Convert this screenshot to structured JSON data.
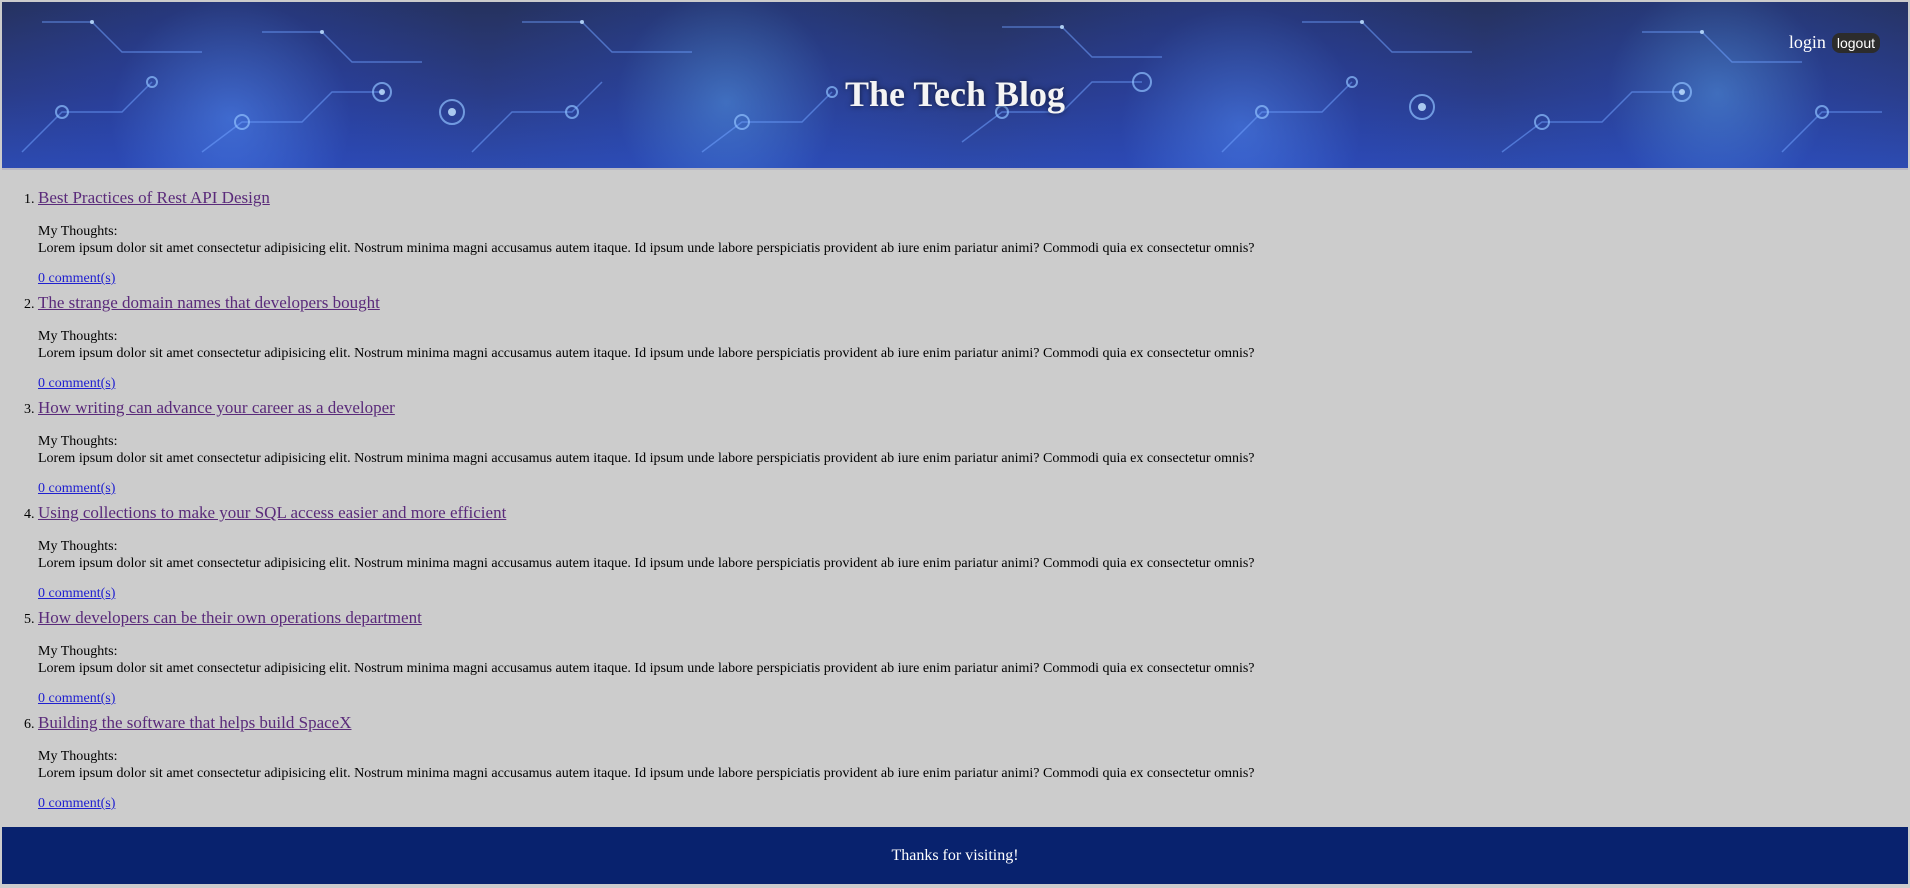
{
  "header": {
    "title": "The Tech Blog",
    "login_label": "login",
    "logout_label": "logout",
    "bg_color": "#2a3c86"
  },
  "posts": [
    {
      "number": "1.",
      "title": "Best Practices of Rest API Design",
      "thoughts_label": "My Thoughts:",
      "body": "Lorem ipsum dolor sit amet consectetur adipisicing elit. Nostrum minima magni accusamus autem itaque. Id ipsum unde labore perspiciatis provident ab iure enim pariatur animi? Commodi quia ex consectetur omnis?",
      "comments": "0 comment(s)"
    },
    {
      "number": "2.",
      "title": "The strange domain names that developers bought",
      "thoughts_label": "My Thoughts:",
      "body": "Lorem ipsum dolor sit amet consectetur adipisicing elit. Nostrum minima magni accusamus autem itaque. Id ipsum unde labore perspiciatis provident ab iure enim pariatur animi? Commodi quia ex consectetur omnis?",
      "comments": "0 comment(s)"
    },
    {
      "number": "3.",
      "title": "How writing can advance your career as a developer",
      "thoughts_label": "My Thoughts:",
      "body": "Lorem ipsum dolor sit amet consectetur adipisicing elit. Nostrum minima magni accusamus autem itaque. Id ipsum unde labore perspiciatis provident ab iure enim pariatur animi? Commodi quia ex consectetur omnis?",
      "comments": "0 comment(s)"
    },
    {
      "number": "4.",
      "title": "Using collections to make your SQL access easier and more efficient",
      "thoughts_label": "My Thoughts:",
      "body": "Lorem ipsum dolor sit amet consectetur adipisicing elit. Nostrum minima magni accusamus autem itaque. Id ipsum unde labore perspiciatis provident ab iure enim pariatur animi? Commodi quia ex consectetur omnis?",
      "comments": "0 comment(s)"
    },
    {
      "number": "5.",
      "title": "How developers can be their own operations department",
      "thoughts_label": "My Thoughts:",
      "body": "Lorem ipsum dolor sit amet consectetur adipisicing elit. Nostrum minima magni accusamus autem itaque. Id ipsum unde labore perspiciatis provident ab iure enim pariatur animi? Commodi quia ex consectetur omnis?",
      "comments": "0 comment(s)"
    },
    {
      "number": "6.",
      "title": "Building the software that helps build SpaceX",
      "thoughts_label": "My Thoughts:",
      "body": "Lorem ipsum dolor sit amet consectetur adipisicing elit. Nostrum minima magni accusamus autem itaque. Id ipsum unde labore perspiciatis provident ab iure enim pariatur animi? Commodi quia ex consectetur omnis?",
      "comments": "0 comment(s)"
    }
  ],
  "footer": {
    "text": "Thanks for visiting!",
    "bg_color": "#08226e"
  },
  "colors": {
    "page_bg": "#cccccc",
    "visited_link": "#5a2a7a",
    "link": "#2020d0"
  }
}
